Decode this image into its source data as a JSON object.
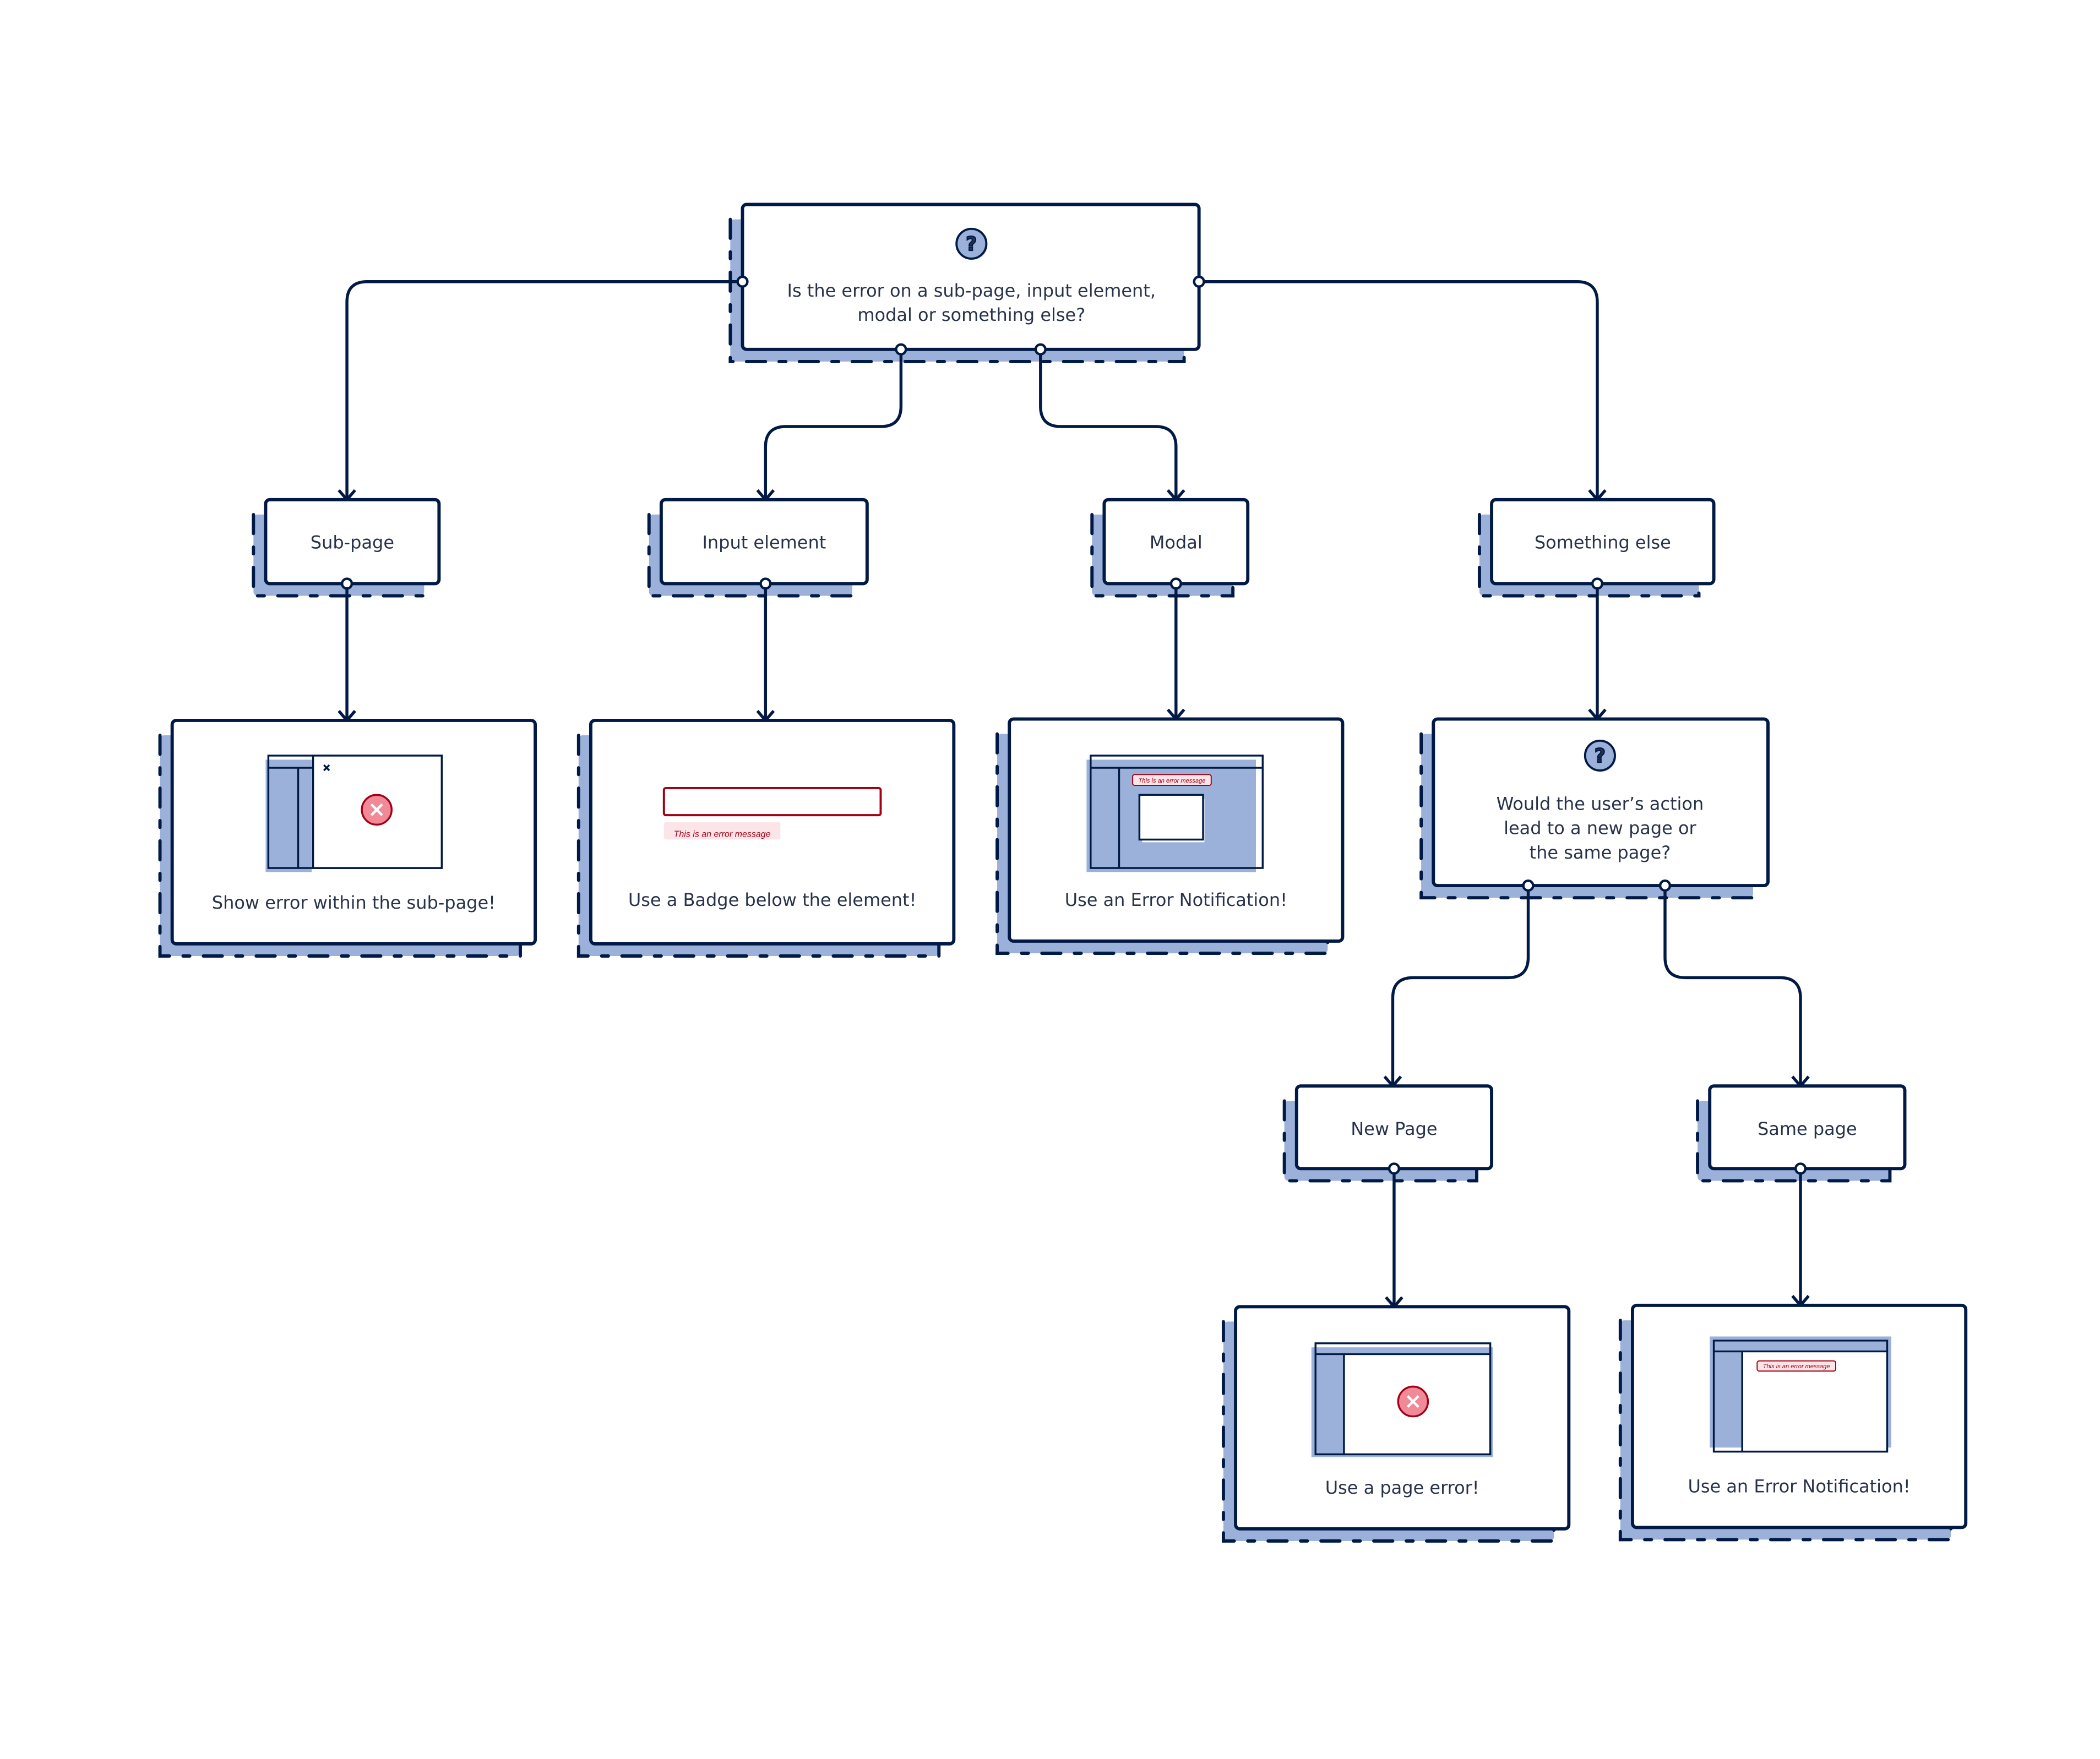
{
  "colors": {
    "stroke": "#001a45",
    "shadow": "#9bb1da",
    "error": "#a30015",
    "error_bg": "#fbe5e8",
    "text": "#28324a"
  },
  "root": {
    "line1": "Is the error on a sub-page, input element,",
    "line2": "modal or something else?",
    "icon": "question-icon"
  },
  "options": {
    "subpage": "Sub-page",
    "input": "Input element",
    "modal": "Modal",
    "else": "Something else",
    "new_page": "New Page",
    "same_page": "Same page"
  },
  "results": {
    "subpage": "Show error within the sub-page!",
    "input": "Use a Badge below the element!",
    "modal": "Use an Error Notification!",
    "new_page": "Use a page error!",
    "same_page": "Use an Error Notification!"
  },
  "question2": {
    "line1": "Would the user’s action",
    "line2": "lead to a new page or",
    "line3": "the same page?",
    "icon": "question-icon"
  },
  "error_message": "This is an error message"
}
